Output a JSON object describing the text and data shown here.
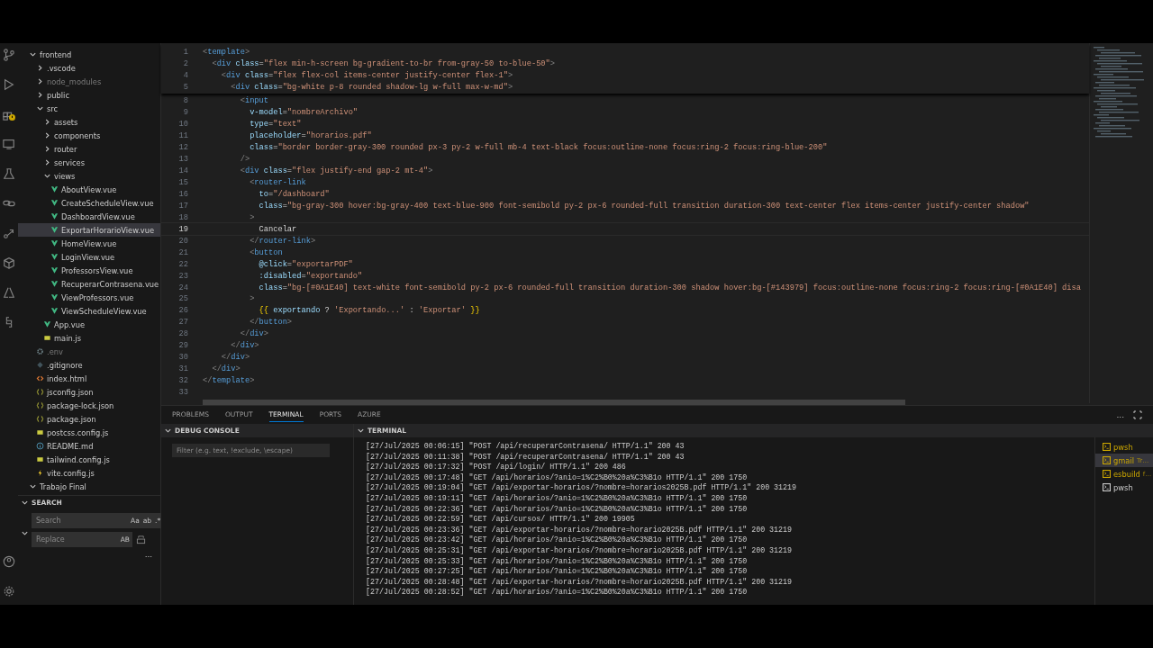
{
  "explorer": {
    "tree": [
      {
        "name": "frontend",
        "kind": "folder",
        "expanded": true,
        "selected": false,
        "ignored": false,
        "children": [
          {
            "name": ".vscode",
            "kind": "folder",
            "expanded": false,
            "selected": false,
            "ignored": false
          },
          {
            "name": "node_modules",
            "kind": "folder",
            "expanded": false,
            "selected": false,
            "ignored": true
          },
          {
            "name": "public",
            "kind": "folder",
            "expanded": false,
            "selected": false,
            "ignored": false
          },
          {
            "name": "src",
            "kind": "folder",
            "expanded": true,
            "selected": false,
            "ignored": false,
            "children": [
              {
                "name": "assets",
                "kind": "folder",
                "expanded": false,
                "selected": false,
                "ignored": false
              },
              {
                "name": "components",
                "kind": "folder",
                "expanded": false,
                "selected": false,
                "ignored": false
              },
              {
                "name": "router",
                "kind": "folder",
                "expanded": false,
                "selected": false,
                "ignored": false
              },
              {
                "name": "services",
                "kind": "folder",
                "expanded": false,
                "selected": false,
                "ignored": false
              },
              {
                "name": "views",
                "kind": "folder",
                "expanded": true,
                "selected": false,
                "ignored": false,
                "children": [
                  {
                    "name": "AboutView.vue",
                    "kind": "vue",
                    "selected": false,
                    "ignored": false
                  },
                  {
                    "name": "CreateScheduleView.vue",
                    "kind": "vue",
                    "selected": false,
                    "ignored": false
                  },
                  {
                    "name": "DashboardView.vue",
                    "kind": "vue",
                    "selected": false,
                    "ignored": false
                  },
                  {
                    "name": "ExportarHorarioView.vue",
                    "kind": "vue",
                    "selected": true,
                    "ignored": false
                  },
                  {
                    "name": "HomeView.vue",
                    "kind": "vue",
                    "selected": false,
                    "ignored": false
                  },
                  {
                    "name": "LoginView.vue",
                    "kind": "vue",
                    "selected": false,
                    "ignored": false
                  },
                  {
                    "name": "ProfessorsView.vue",
                    "kind": "vue",
                    "selected": false,
                    "ignored": false
                  },
                  {
                    "name": "RecuperarContrasena.vue",
                    "kind": "vue",
                    "selected": false,
                    "ignored": false
                  },
                  {
                    "name": "ViewProfessors.vue",
                    "kind": "vue",
                    "selected": false,
                    "ignored": false
                  },
                  {
                    "name": "ViewScheduleView.vue",
                    "kind": "vue",
                    "selected": false,
                    "ignored": false
                  }
                ]
              },
              {
                "name": "App.vue",
                "kind": "vue",
                "selected": false,
                "ignored": false
              },
              {
                "name": "main.js",
                "kind": "js",
                "selected": false,
                "ignored": false
              }
            ]
          },
          {
            "name": ".env",
            "kind": "gear",
            "selected": false,
            "ignored": true
          },
          {
            "name": ".gitignore",
            "kind": "git",
            "selected": false,
            "ignored": false
          },
          {
            "name": "index.html",
            "kind": "html",
            "selected": false,
            "ignored": false
          },
          {
            "name": "jsconfig.json",
            "kind": "json",
            "selected": false,
            "ignored": false
          },
          {
            "name": "package-lock.json",
            "kind": "json",
            "selected": false,
            "ignored": false
          },
          {
            "name": "package.json",
            "kind": "json",
            "selected": false,
            "ignored": false
          },
          {
            "name": "postcss.config.js",
            "kind": "js",
            "selected": false,
            "ignored": false
          },
          {
            "name": "README.md",
            "kind": "info",
            "selected": false,
            "ignored": false
          },
          {
            "name": "tailwind.config.js",
            "kind": "js",
            "selected": false,
            "ignored": false
          },
          {
            "name": "vite.config.js",
            "kind": "vite",
            "selected": false,
            "ignored": false
          }
        ]
      },
      {
        "name": "Trabajo Final",
        "kind": "folder",
        "expanded": true,
        "selected": false,
        "ignored": false
      }
    ]
  },
  "search": {
    "title": "SEARCH",
    "expanded": true,
    "search_placeholder": "Search",
    "toggles": [
      "Aa",
      "ab",
      ".*"
    ],
    "replace_placeholder": "Replace",
    "replace_toggle": "AB",
    "more": "..."
  },
  "editor": {
    "sticky_lines": [
      {
        "num": "1",
        "tokens": [
          {
            "kind": "punct",
            "text": "<"
          },
          {
            "kind": "tag",
            "text": "template"
          },
          {
            "kind": "punct",
            "text": ">"
          }
        ]
      },
      {
        "num": "2",
        "tokens": [
          {
            "kind": "punct",
            "text": "  <"
          },
          {
            "kind": "tag",
            "text": "div"
          },
          {
            "kind": "attr",
            "text": " class"
          },
          {
            "kind": "plain",
            "text": "="
          },
          {
            "kind": "str",
            "text": "\"flex min-h-screen bg-gradient-to-br from-gray-50 to-blue-50\""
          },
          {
            "kind": "punct",
            "text": ">"
          }
        ]
      },
      {
        "num": "4",
        "tokens": [
          {
            "kind": "punct",
            "text": "    <"
          },
          {
            "kind": "tag",
            "text": "div"
          },
          {
            "kind": "attr",
            "text": " class"
          },
          {
            "kind": "plain",
            "text": "="
          },
          {
            "kind": "str",
            "text": "\"flex flex-col items-center justify-center flex-1\""
          },
          {
            "kind": "punct",
            "text": ">"
          }
        ]
      },
      {
        "num": "5",
        "tokens": [
          {
            "kind": "punct",
            "text": "      <"
          },
          {
            "kind": "tag",
            "text": "div"
          },
          {
            "kind": "attr",
            "text": " class"
          },
          {
            "kind": "plain",
            "text": "="
          },
          {
            "kind": "str",
            "text": "\"bg-white p-8 rounded shadow-lg w-full max-w-md\""
          },
          {
            "kind": "punct",
            "text": ">"
          }
        ]
      }
    ],
    "lines": [
      {
        "num": "8",
        "current": false,
        "tokens": [
          {
            "kind": "punct",
            "text": "        <"
          },
          {
            "kind": "tag",
            "text": "input"
          }
        ]
      },
      {
        "num": "9",
        "current": false,
        "tokens": [
          {
            "kind": "attr",
            "text": "          v-model"
          },
          {
            "kind": "plain",
            "text": "="
          },
          {
            "kind": "str",
            "text": "\"nombreArchivo\""
          }
        ]
      },
      {
        "num": "10",
        "current": false,
        "tokens": [
          {
            "kind": "attr",
            "text": "          type"
          },
          {
            "kind": "plain",
            "text": "="
          },
          {
            "kind": "str",
            "text": "\"text\""
          }
        ]
      },
      {
        "num": "11",
        "current": false,
        "tokens": [
          {
            "kind": "attr",
            "text": "          placeholder"
          },
          {
            "kind": "plain",
            "text": "="
          },
          {
            "kind": "str",
            "text": "\"horarios.pdf\""
          }
        ]
      },
      {
        "num": "12",
        "current": false,
        "tokens": [
          {
            "kind": "attr",
            "text": "          class"
          },
          {
            "kind": "plain",
            "text": "="
          },
          {
            "kind": "str",
            "text": "\"border border-gray-300 rounded px-3 py-2 w-full mb-4 text-black focus:outline-none focus:ring-2 focus:ring-blue-200\""
          }
        ]
      },
      {
        "num": "13",
        "current": false,
        "tokens": [
          {
            "kind": "punct",
            "text": "        />"
          }
        ]
      },
      {
        "num": "14",
        "current": false,
        "tokens": [
          {
            "kind": "punct",
            "text": "        <"
          },
          {
            "kind": "tag",
            "text": "div"
          },
          {
            "kind": "attr",
            "text": " class"
          },
          {
            "kind": "plain",
            "text": "="
          },
          {
            "kind": "str",
            "text": "\"flex justify-end gap-2 mt-4\""
          },
          {
            "kind": "punct",
            "text": ">"
          }
        ]
      },
      {
        "num": "15",
        "current": false,
        "tokens": [
          {
            "kind": "punct",
            "text": "          <"
          },
          {
            "kind": "tag",
            "text": "router-link"
          }
        ]
      },
      {
        "num": "16",
        "current": false,
        "tokens": [
          {
            "kind": "attr",
            "text": "            to"
          },
          {
            "kind": "plain",
            "text": "="
          },
          {
            "kind": "str",
            "text": "\"/dashboard\""
          }
        ]
      },
      {
        "num": "17",
        "current": false,
        "tokens": [
          {
            "kind": "attr",
            "text": "            class"
          },
          {
            "kind": "plain",
            "text": "="
          },
          {
            "kind": "str",
            "text": "\"bg-gray-300 hover:bg-gray-400 text-blue-900 font-semibold py-2 px-6 rounded-full transition duration-300 text-center flex items-center justify-center shadow\""
          }
        ]
      },
      {
        "num": "18",
        "current": false,
        "tokens": [
          {
            "kind": "punct",
            "text": "          >"
          }
        ]
      },
      {
        "num": "19",
        "current": true,
        "tokens": [
          {
            "kind": "plain",
            "text": "            Cancelar"
          }
        ]
      },
      {
        "num": "20",
        "current": false,
        "tokens": [
          {
            "kind": "punct",
            "text": "          </"
          },
          {
            "kind": "tag",
            "text": "router-link"
          },
          {
            "kind": "punct",
            "text": ">"
          }
        ]
      },
      {
        "num": "21",
        "current": false,
        "tokens": [
          {
            "kind": "punct",
            "text": "          <"
          },
          {
            "kind": "tag",
            "text": "button"
          }
        ]
      },
      {
        "num": "22",
        "current": false,
        "tokens": [
          {
            "kind": "attr",
            "text": "            @click"
          },
          {
            "kind": "plain",
            "text": "="
          },
          {
            "kind": "str",
            "text": "\"exportarPDF\""
          }
        ]
      },
      {
        "num": "23",
        "current": false,
        "tokens": [
          {
            "kind": "attr",
            "text": "            :disabled"
          },
          {
            "kind": "plain",
            "text": "="
          },
          {
            "kind": "str",
            "text": "\"exportando\""
          }
        ]
      },
      {
        "num": "24",
        "current": false,
        "tokens": [
          {
            "kind": "attr",
            "text": "            class"
          },
          {
            "kind": "plain",
            "text": "="
          },
          {
            "kind": "str",
            "text": "\"bg-[#0A1E40] text-white font-semibold py-2 px-6 rounded-full transition duration-300 shadow hover:bg-[#143979] focus:outline-none focus:ring-2 focus:ring-[#0A1E40] disa"
          }
        ]
      },
      {
        "num": "25",
        "current": false,
        "tokens": [
          {
            "kind": "punct",
            "text": "          >"
          }
        ]
      },
      {
        "num": "26",
        "current": false,
        "tokens": [
          {
            "kind": "brace",
            "text": "            {{"
          },
          {
            "kind": "var",
            "text": " exportando "
          },
          {
            "kind": "plain",
            "text": "? "
          },
          {
            "kind": "str",
            "text": "'Exportando...'"
          },
          {
            "kind": "plain",
            "text": " : "
          },
          {
            "kind": "str",
            "text": "'Exportar'"
          },
          {
            "kind": "brace",
            "text": " }}"
          }
        ]
      },
      {
        "num": "27",
        "current": false,
        "tokens": [
          {
            "kind": "punct",
            "text": "          </"
          },
          {
            "kind": "tag",
            "text": "button"
          },
          {
            "kind": "punct",
            "text": ">"
          }
        ]
      },
      {
        "num": "28",
        "current": false,
        "tokens": [
          {
            "kind": "punct",
            "text": "        </"
          },
          {
            "kind": "tag",
            "text": "div"
          },
          {
            "kind": "punct",
            "text": ">"
          }
        ]
      },
      {
        "num": "29",
        "current": false,
        "tokens": [
          {
            "kind": "punct",
            "text": "      </"
          },
          {
            "kind": "tag",
            "text": "div"
          },
          {
            "kind": "punct",
            "text": ">"
          }
        ]
      },
      {
        "num": "30",
        "current": false,
        "tokens": [
          {
            "kind": "punct",
            "text": "    </"
          },
          {
            "kind": "tag",
            "text": "div"
          },
          {
            "kind": "punct",
            "text": ">"
          }
        ]
      },
      {
        "num": "31",
        "current": false,
        "tokens": [
          {
            "kind": "punct",
            "text": "  </"
          },
          {
            "kind": "tag",
            "text": "div"
          },
          {
            "kind": "punct",
            "text": ">"
          }
        ]
      },
      {
        "num": "32",
        "current": false,
        "tokens": [
          {
            "kind": "punct",
            "text": "</"
          },
          {
            "kind": "tag",
            "text": "template"
          },
          {
            "kind": "punct",
            "text": ">"
          }
        ]
      },
      {
        "num": "33",
        "current": false
      }
    ]
  },
  "panel": {
    "tabs": [
      {
        "label": "PROBLEMS",
        "selected": false
      },
      {
        "label": "OUTPUT",
        "selected": false
      },
      {
        "label": "TERMINAL",
        "selected": true
      },
      {
        "label": "PORTS",
        "selected": false
      },
      {
        "label": "AZURE",
        "selected": false
      }
    ],
    "more": "...",
    "debug_console": {
      "title": "DEBUG CONSOLE",
      "filter_placeholder": "Filter (e.g. text, !exclude, \\escape)"
    },
    "terminal": {
      "title": "TERMINAL",
      "lines": [
        "[27/Jul/2025 00:06:15] \"POST /api/recuperarContrasena/ HTTP/1.1\" 200 43",
        "[27/Jul/2025 00:11:38] \"POST /api/recuperarContrasena/ HTTP/1.1\" 200 43",
        "[27/Jul/2025 00:17:32] \"POST /api/login/ HTTP/1.1\" 200 486",
        "[27/Jul/2025 00:17:48] \"GET /api/horarios/?anio=1%C2%B0%20a%C3%B1o HTTP/1.1\" 200 1750",
        "[27/Jul/2025 00:19:04] \"GET /api/exportar-horarios/?nombre=horarios2025B.pdf HTTP/1.1\" 200 31219",
        "[27/Jul/2025 00:19:11] \"GET /api/horarios/?anio=1%C2%B0%20a%C3%B1o HTTP/1.1\" 200 1750",
        "[27/Jul/2025 00:22:36] \"GET /api/horarios/?anio=1%C2%B0%20a%C3%B1o HTTP/1.1\" 200 1750",
        "[27/Jul/2025 00:22:59] \"GET /api/cursos/ HTTP/1.1\" 200 19905",
        "[27/Jul/2025 00:23:36] \"GET /api/exportar-horarios/?nombre=horario2025B.pdf HTTP/1.1\" 200 31219",
        "[27/Jul/2025 00:23:42] \"GET /api/horarios/?anio=1%C2%B0%20a%C3%B1o HTTP/1.1\" 200 1750",
        "[27/Jul/2025 00:25:31] \"GET /api/exportar-horarios/?nombre=horario2025B.pdf HTTP/1.1\" 200 31219",
        "[27/Jul/2025 00:25:33] \"GET /api/horarios/?anio=1%C2%B0%20a%C3%B1o HTTP/1.1\" 200 1750",
        "[27/Jul/2025 00:27:25] \"GET /api/horarios/?anio=1%C2%B0%20a%C3%B1o HTTP/1.1\" 200 1750",
        "[27/Jul/2025 00:28:48] \"GET /api/exportar-horarios/?nombre=horario2025B.pdf HTTP/1.1\" 200 31219",
        "[27/Jul/2025 00:28:52] \"GET /api/horarios/?anio=1%C2%B0%20a%C3%B1o HTTP/1.1\" 200 1750"
      ],
      "sessions": [
        {
          "name": "pwsh",
          "color": "#cca700",
          "selected": false
        },
        {
          "name": "gmail",
          "detail": "Tr…",
          "color": "#cca700",
          "selected": true
        },
        {
          "name": "esbuild",
          "detail": "f…",
          "color": "#cca700",
          "selected": false
        },
        {
          "name": "pwsh",
          "color": "#cccccc",
          "selected": false
        }
      ]
    }
  }
}
